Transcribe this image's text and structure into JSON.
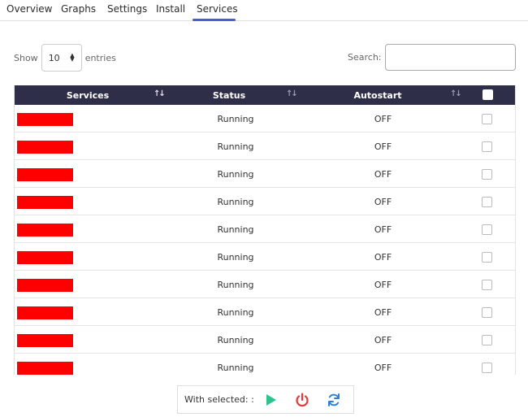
{
  "tabs": [
    {
      "label": "Overview"
    },
    {
      "label": "Graphs"
    },
    {
      "label": "Settings"
    },
    {
      "label": "Install"
    },
    {
      "label": "Services",
      "active": true
    }
  ],
  "length": {
    "show_label": "Show",
    "value": "10",
    "entries_label": "entries"
  },
  "search": {
    "label": "Search:",
    "value": ""
  },
  "table": {
    "columns": [
      "Services",
      "Status",
      "Autostart"
    ],
    "rows": [
      {
        "status": "Running",
        "autostart": "OFF"
      },
      {
        "status": "Running",
        "autostart": "OFF"
      },
      {
        "status": "Running",
        "autostart": "OFF"
      },
      {
        "status": "Running",
        "autostart": "OFF"
      },
      {
        "status": "Running",
        "autostart": "OFF"
      },
      {
        "status": "Running",
        "autostart": "OFF"
      },
      {
        "status": "Running",
        "autostart": "OFF"
      },
      {
        "status": "Running",
        "autostart": "OFF"
      },
      {
        "status": "Running",
        "autostart": "OFF"
      },
      {
        "status": "Running",
        "autostart": "OFF"
      }
    ]
  },
  "actions": {
    "label": "With selected: :",
    "start_icon": "play-icon",
    "stop_icon": "power-icon",
    "restart_icon": "refresh-icon"
  },
  "colors": {
    "header_bg": "#2f2e48",
    "tab_accent": "#4f5bd5",
    "redaction": "#ff0000",
    "play": "#2ec28f",
    "power": "#e03a3a",
    "refresh": "#2f7fd6"
  }
}
